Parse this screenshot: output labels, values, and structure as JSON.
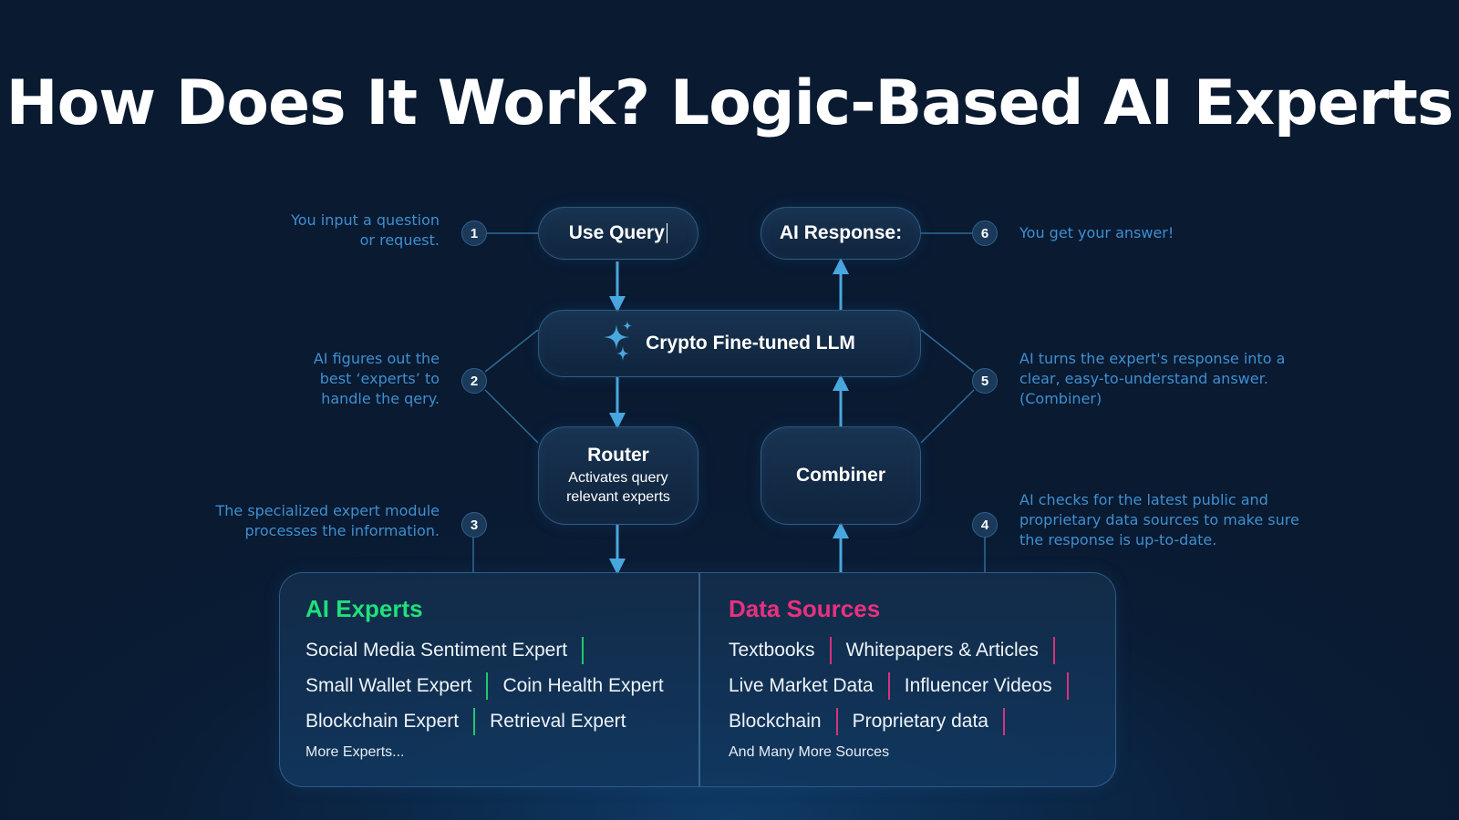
{
  "title": "How Does It Work? Logic-Based AI Experts",
  "colors": {
    "background": "#0a1d36",
    "accent_blue": "#4aa8e0",
    "note_text": "#3f8fcf",
    "ai_experts_title": "#1fe07a",
    "data_sources_title": "#e8317e",
    "separator_green": "#20c96b",
    "separator_pink": "#d8327c"
  },
  "nodes": {
    "use_query": {
      "label": "Use Query",
      "icon": "text-caret-icon"
    },
    "ai_response": {
      "label": "AI Response:"
    },
    "llm": {
      "label": "Crypto Fine-tuned LLM",
      "icon": "sparkles-icon"
    },
    "router": {
      "title": "Router",
      "subtitle_line1": "Activates query",
      "subtitle_line2": "relevant experts"
    },
    "combiner": {
      "title": "Combiner"
    }
  },
  "steps": [
    {
      "number": "1",
      "note_line1": "You input a question",
      "note_line2": "or request."
    },
    {
      "number": "2",
      "note_line1": "AI figures out the",
      "note_line2": "best ‘experts’ to",
      "note_line3": "handle the qery."
    },
    {
      "number": "3",
      "note_line1": "The specialized expert module",
      "note_line2": "processes the information."
    },
    {
      "number": "4",
      "note_line1": "AI checks for the latest  public and",
      "note_line2": "proprietary data sources to make sure",
      "note_line3": "the response is up-to-date."
    },
    {
      "number": "5",
      "note_line1": "AI turns the expert's response into a",
      "note_line2": "clear, easy-to-understand answer.",
      "note_line3": "(Combiner)"
    },
    {
      "number": "6",
      "note_line1": "You get your answer!"
    }
  ],
  "ai_experts": {
    "title": "AI Experts",
    "rows": [
      [
        "Social Media Sentiment Expert"
      ],
      [
        "Small Wallet Expert",
        "Coin Health Expert"
      ],
      [
        "Blockchain Expert",
        "Retrieval Expert"
      ]
    ],
    "more": "More Experts..."
  },
  "data_sources": {
    "title": "Data Sources",
    "rows": [
      [
        "Textbooks",
        "Whitepapers & Articles"
      ],
      [
        "Live Market Data",
        "Influencer Videos"
      ],
      [
        "Blockchain",
        "Proprietary data"
      ]
    ],
    "more": "And Many More Sources"
  }
}
